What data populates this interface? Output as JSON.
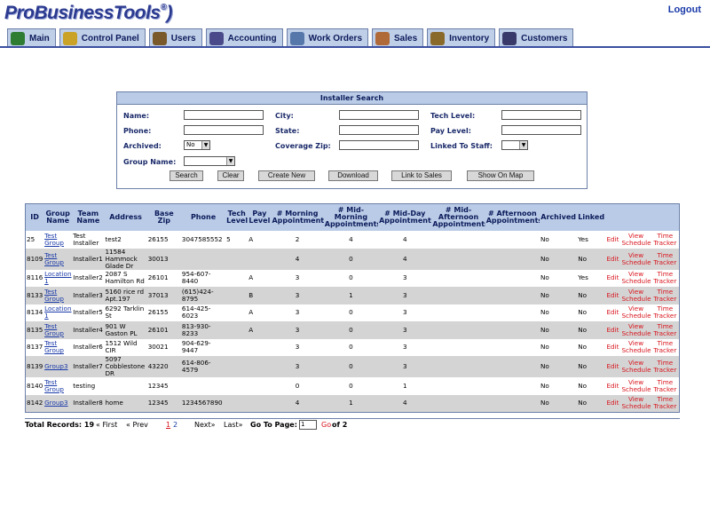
{
  "header": {
    "logo_text": "ProBusinessTools",
    "logo_reg": "®",
    "logout": "Logout"
  },
  "tabs": [
    {
      "label": "Main",
      "icon": "globe-icon",
      "color": "#2e7d32"
    },
    {
      "label": "Control Panel",
      "icon": "wrench-icon",
      "color": "#c9a227"
    },
    {
      "label": "Users",
      "icon": "users-icon",
      "color": "#7a5a2a"
    },
    {
      "label": "Accounting",
      "icon": "accountant-icon",
      "color": "#4a4a8a"
    },
    {
      "label": "Work Orders",
      "icon": "truck-icon",
      "color": "#5577aa"
    },
    {
      "label": "Sales",
      "icon": "handshake-icon",
      "color": "#b06a3a"
    },
    {
      "label": "Inventory",
      "icon": "box-icon",
      "color": "#8a6a2a"
    },
    {
      "label": "Customers",
      "icon": "customers-icon",
      "color": "#3a3a6a"
    }
  ],
  "search": {
    "title": "Installer Search",
    "labels": {
      "name": "Name:",
      "phone": "Phone:",
      "archived": "Archived:",
      "group_name": "Group Name:",
      "city": "City:",
      "state": "State:",
      "coverage_zip": "Coverage Zip:",
      "tech_level": "Tech Level:",
      "pay_level": "Pay Level:",
      "linked_to_staff": "Linked To Staff:"
    },
    "archived_value": "No",
    "group_value": "",
    "linked_value": "",
    "buttons": {
      "search": "Search",
      "clear": "Clear",
      "create_new": "Create New",
      "download": "Download",
      "link_to_sales": "Link to Sales",
      "show_on_map": "Show On Map"
    }
  },
  "grid": {
    "headers": [
      "ID",
      "Group Name",
      "Team Name",
      "Address",
      "Base Zip",
      "Phone",
      "Tech Level",
      "Pay Level",
      "# Morning Appointments",
      "# Mid-Morning Appointments",
      "# Mid-Day Appointments",
      "# Mid-Afternoon Appointments",
      "# Afternoon Appointments",
      "Archived",
      "Linked"
    ],
    "rows": [
      {
        "id": "25",
        "group": "Test Group",
        "team": "Test Installer",
        "address": "test2",
        "zip": "26155",
        "phone": "3047585552",
        "tech": "5",
        "pay": "A",
        "morn": "2",
        "midmorn": "4",
        "midday": "4",
        "midaft": "",
        "aft": "",
        "archived": "No",
        "linked": "Yes"
      },
      {
        "id": "8109",
        "group": "Test Group",
        "team": "Installer1",
        "address": "11584 Hammock Glade Dr",
        "zip": "30013",
        "phone": "",
        "tech": "",
        "pay": "",
        "morn": "4",
        "midmorn": "0",
        "midday": "4",
        "midaft": "",
        "aft": "",
        "archived": "No",
        "linked": "No"
      },
      {
        "id": "8116",
        "group": "Location 1",
        "team": "Installer2",
        "address": "2087 S Hamilton Rd",
        "zip": "26101",
        "phone": "954-607-8440",
        "tech": "",
        "pay": "A",
        "morn": "3",
        "midmorn": "0",
        "midday": "3",
        "midaft": "",
        "aft": "",
        "archived": "No",
        "linked": "Yes"
      },
      {
        "id": "8133",
        "group": "Test Group",
        "team": "Installer3",
        "address": "5160 rice rd Apt.197",
        "zip": "37013",
        "phone": "(615)424-8795",
        "tech": "",
        "pay": "B",
        "morn": "3",
        "midmorn": "1",
        "midday": "3",
        "midaft": "",
        "aft": "",
        "archived": "No",
        "linked": "No"
      },
      {
        "id": "8134",
        "group": "Location 1",
        "team": "Installer5",
        "address": "6292 Tarklin St",
        "zip": "26155",
        "phone": "614-425-6023",
        "tech": "",
        "pay": "A",
        "morn": "3",
        "midmorn": "0",
        "midday": "3",
        "midaft": "",
        "aft": "",
        "archived": "No",
        "linked": "No"
      },
      {
        "id": "8135",
        "group": "Test Group",
        "team": "Installer4",
        "address": "901 W Gaston PL",
        "zip": "26101",
        "phone": "813-930-8233",
        "tech": "",
        "pay": "A",
        "morn": "3",
        "midmorn": "0",
        "midday": "3",
        "midaft": "",
        "aft": "",
        "archived": "No",
        "linked": "No"
      },
      {
        "id": "8137",
        "group": "Test Group",
        "team": "Installer6",
        "address": "1512 Wild CIR",
        "zip": "30021",
        "phone": "904-629-9447",
        "tech": "",
        "pay": "",
        "morn": "3",
        "midmorn": "0",
        "midday": "3",
        "midaft": "",
        "aft": "",
        "archived": "No",
        "linked": "No"
      },
      {
        "id": "8139",
        "group": "Group3",
        "team": "Installer7",
        "address": "5097 Cobblestone DR",
        "zip": "43220",
        "phone": "614-806-4579",
        "tech": "",
        "pay": "",
        "morn": "3",
        "midmorn": "0",
        "midday": "3",
        "midaft": "",
        "aft": "",
        "archived": "No",
        "linked": "No"
      },
      {
        "id": "8140",
        "group": "Test Group",
        "team": "testing",
        "address": "",
        "zip": "12345",
        "phone": "",
        "tech": "",
        "pay": "",
        "morn": "0",
        "midmorn": "0",
        "midday": "1",
        "midaft": "",
        "aft": "",
        "archived": "No",
        "linked": "No"
      },
      {
        "id": "8142",
        "group": "Group3",
        "team": "Installer8",
        "address": "home",
        "zip": "12345",
        "phone": "1234567890",
        "tech": "",
        "pay": "",
        "morn": "4",
        "midmorn": "1",
        "midday": "4",
        "midaft": "",
        "aft": "",
        "archived": "No",
        "linked": "No"
      }
    ],
    "actions": {
      "edit": "Edit",
      "view_schedule": "View Schedule",
      "time_tracker": "Time Tracker"
    }
  },
  "footer": {
    "total": "Total Records: 19",
    "first": "« First",
    "prev": "« Prev",
    "page1": "1",
    "page2": "2",
    "next": "Next»",
    "last": "Last»",
    "goto": "Go To Page:",
    "goto_value": "1",
    "go": "Go",
    "of": "of 2"
  }
}
